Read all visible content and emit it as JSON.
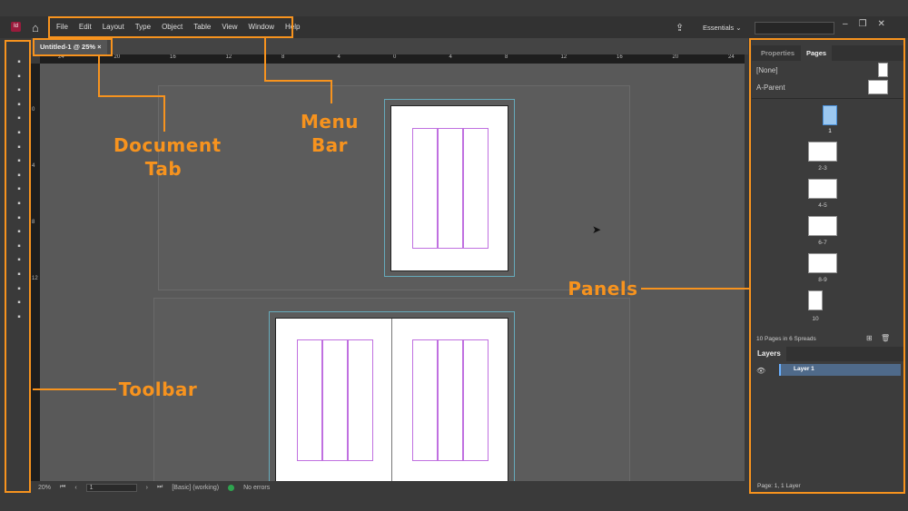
{
  "app": {
    "logo": "Id",
    "workspace": "Essentials"
  },
  "menu": [
    "File",
    "Edit",
    "Layout",
    "Type",
    "Object",
    "Table",
    "View",
    "Window",
    "Help"
  ],
  "document_tab": {
    "title": "Untitled-1 @ 25%",
    "close": "×"
  },
  "ruler_top": [
    "24",
    "20",
    "16",
    "12",
    "8",
    "4",
    "0",
    "4",
    "8",
    "12",
    "16",
    "20",
    "24"
  ],
  "ruler_left": [
    "0",
    "4",
    "8",
    "12"
  ],
  "status": {
    "zoom": "20%",
    "page": "1",
    "style": "[Basic] (working)",
    "preflight": "No errors",
    "preflight_color": "#2ea44f"
  },
  "panels": {
    "tabs": [
      "Properties",
      "Pages"
    ],
    "parents": [
      "[None]",
      "A-Parent"
    ],
    "page_labels": [
      "1",
      "2-3",
      "4-5",
      "6-7",
      "8-9",
      "10"
    ],
    "pages_summary": "10 Pages in 6 Spreads",
    "layers_title": "Layers",
    "layer": "Layer 1",
    "layers_summary": "Page: 1, 1 Layer"
  },
  "annotations": {
    "menu_bar": "Menu Bar",
    "document_tab": "Document Tab",
    "panels": "Panels",
    "toolbar": "Toolbar",
    "color": "#f7931e"
  }
}
